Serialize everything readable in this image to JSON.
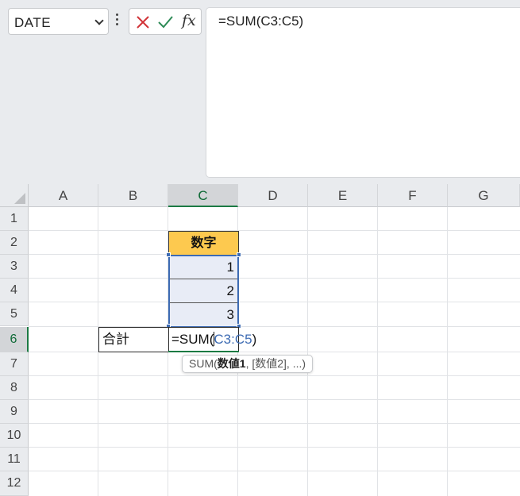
{
  "formula_bar": {
    "name_box": "DATE",
    "formula": "=SUM(C3:C5)"
  },
  "columns": [
    "A",
    "B",
    "C",
    "D",
    "E",
    "F",
    "G"
  ],
  "rows": [
    "1",
    "2",
    "3",
    "4",
    "5",
    "6",
    "7",
    "8",
    "9",
    "10",
    "11",
    "12"
  ],
  "cells": {
    "C2": "数字",
    "C3": "1",
    "C4": "2",
    "C5": "3",
    "B6": "合計"
  },
  "editing": {
    "prefix": "=SUM(",
    "range_ref": "C3:C5",
    "suffix": ")"
  },
  "tooltip": {
    "func": "SUM(",
    "arg1": "数値1",
    "rest": ", [数値2], ...)"
  },
  "colors": {
    "header_fill": "#fdc94f",
    "range_fill": "#e8ecf6",
    "range_border": "#3d6bb3",
    "active_green": "#1b7a43"
  }
}
